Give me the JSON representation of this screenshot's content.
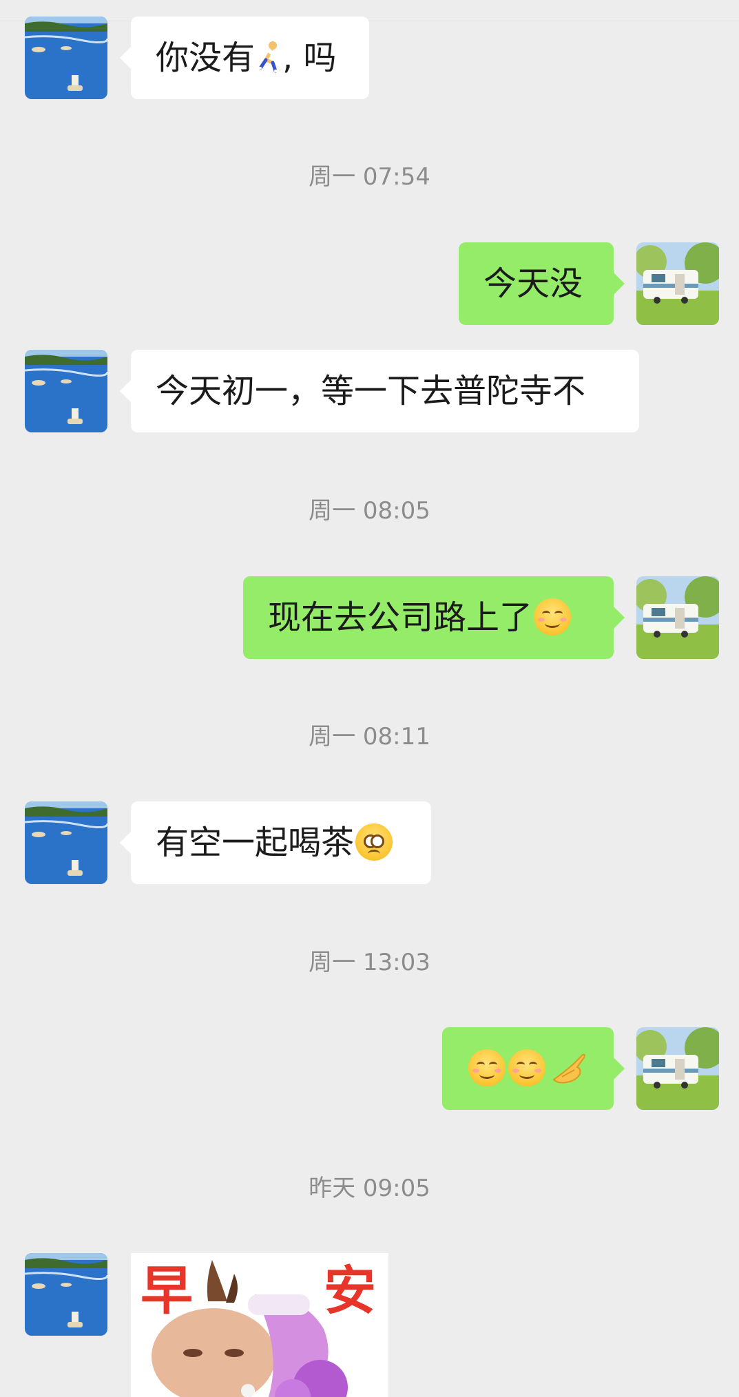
{
  "messages": [
    {
      "side": "in",
      "text": "你没有",
      "after": "吗"
    },
    {
      "side": "out",
      "text": "今天没"
    },
    {
      "side": "in",
      "text": "今天初一，等一下去普陀寺不"
    },
    {
      "side": "out",
      "text": "现在去公司路上了"
    },
    {
      "side": "in",
      "text": "有空一起喝茶"
    },
    {
      "side": "out",
      "text": ""
    }
  ],
  "timestamps": [
    "周一 07:54",
    "周一 08:05",
    "周一 08:11",
    "周一 13:03",
    "昨天 09:05"
  ],
  "sticker": {
    "left_char": "早",
    "right_char": "安"
  },
  "icons": {
    "runner": "runner-emoji-icon",
    "smile": "smiling-face-emoji-icon",
    "pleading": "pleading-face-emoji-icon",
    "ok_hand": "ok-hand-emoji-icon"
  },
  "colors": {
    "background": "#ededed",
    "incoming_bubble": "#ffffff",
    "outgoing_bubble": "#95ec69",
    "timestamp": "#8c8c8c"
  }
}
